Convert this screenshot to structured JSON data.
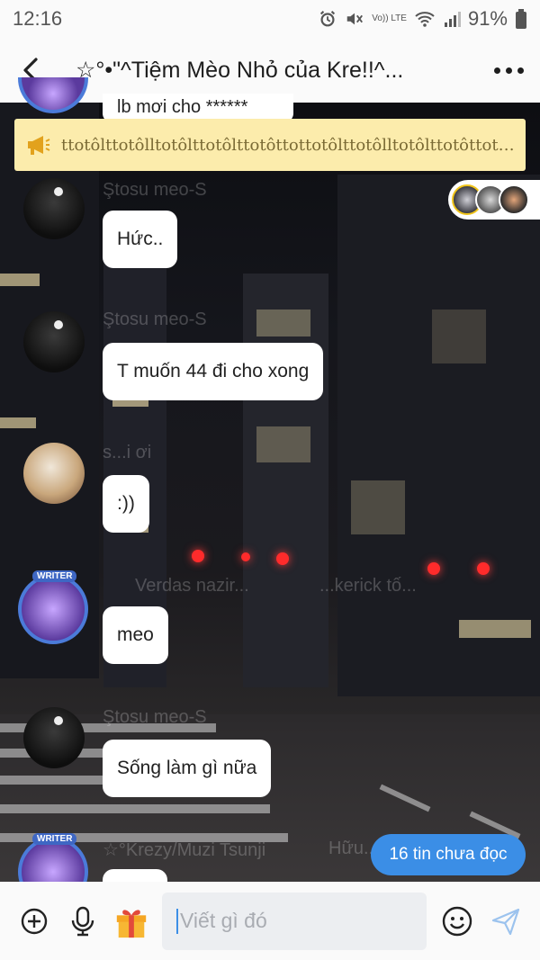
{
  "status_bar": {
    "time": "12:16",
    "volte": "Vo)) LTE",
    "battery": "91%"
  },
  "header": {
    "title": "☆°•\"^Tiệm Mèo Nhỏ của Kre!!^..."
  },
  "announcement": {
    "text": "ttotôlttotôlltotôlttotôlttotôttottotôlttotôlltotôlttotôttottotô..."
  },
  "messages": [
    {
      "text": "lb mơi cho ******"
    },
    {
      "text": "Hức.."
    },
    {
      "text": "T muốn 44 đi cho xong"
    },
    {
      "text": ":))"
    },
    {
      "text": "meo"
    },
    {
      "text": "Sống làm gì nữa"
    }
  ],
  "ghost_names": {
    "n1": "Ştosu meo-S",
    "n2": "Ştosu meo-S",
    "n3": "s...i ơi",
    "n4": "Verdas nazir...",
    "n5": "...kerick tố...",
    "n6": "Ştosu meo-S",
    "n7": "☆°Krezy/Muzi Tsunji",
    "n8": "Hữu..."
  },
  "badges": {
    "writer": "WRITER"
  },
  "unread_label": "16 tin chưa đọc",
  "composer": {
    "placeholder": "Viết gì đó"
  }
}
